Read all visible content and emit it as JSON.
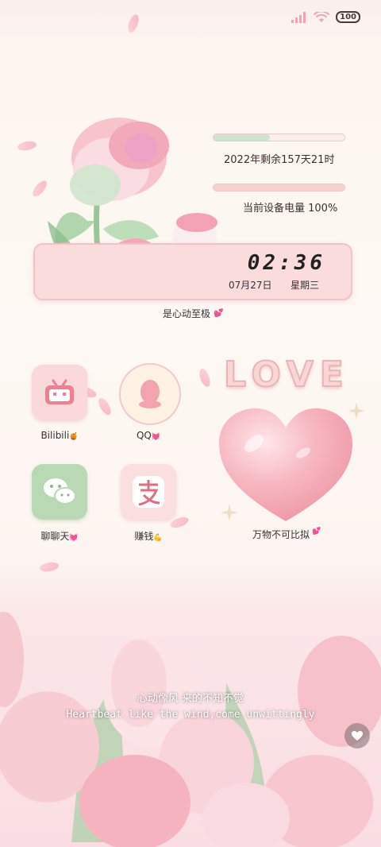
{
  "status": {
    "battery": "100"
  },
  "widgets": {
    "year_remaining": {
      "text": "2022年剩余157天21时",
      "progress": 0.43,
      "color": "#cfe5cf"
    },
    "battery": {
      "text": "当前设备电量 100%",
      "progress": 1.0,
      "color": "#f7d0d0"
    }
  },
  "clock": {
    "time": "02:36",
    "date": "07月27日",
    "weekday": "星期三"
  },
  "tagline": "是心动至极",
  "apps": [
    {
      "label": "Bilibili",
      "icon": "tv-icon"
    },
    {
      "label": "QQ",
      "icon": "penguin-icon"
    },
    {
      "label": "聊聊天",
      "icon": "wechat-icon"
    },
    {
      "label": "赚钱",
      "icon": "alipay-icon"
    }
  ],
  "love_text": "LOVE",
  "heart_caption": "万物不可比拟",
  "subtitle": {
    "line1": "心动像风  来的不知不觉",
    "line2": "Heartbeat like the wind,come unwittingly"
  },
  "colors": {
    "pink": "#f6b3bf",
    "green": "#cfe5cf",
    "background": "#fdf8f3"
  }
}
